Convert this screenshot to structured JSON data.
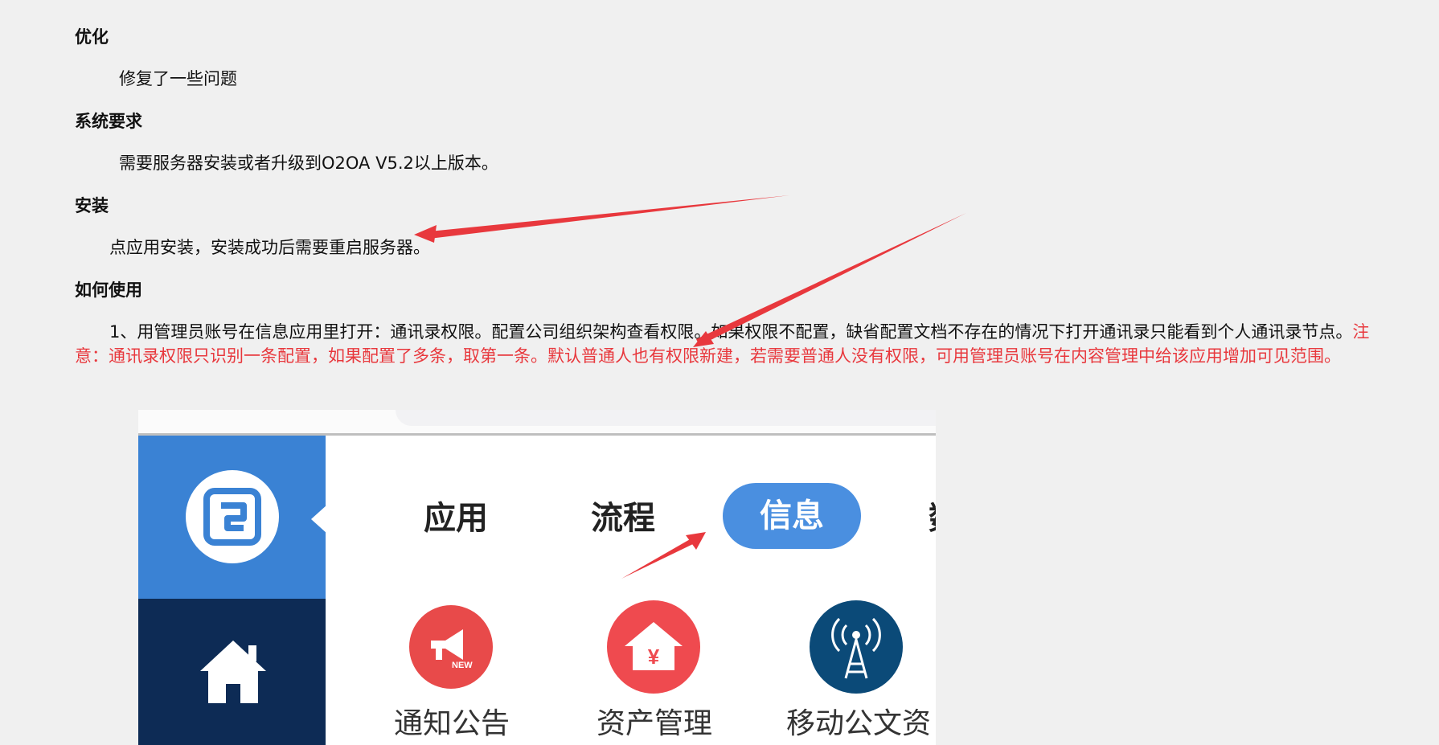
{
  "sections": {
    "optimize": {
      "heading": "优化",
      "text": "修复了一些问题"
    },
    "requirements": {
      "heading": "系统要求",
      "text": "需要服务器安装或者升级到O2OA V5.2以上版本。"
    },
    "install": {
      "heading": "安装",
      "text": "点应用安装，安装成功后需要重启服务器。"
    },
    "usage": {
      "heading": "如何使用",
      "text": "1、用管理员账号在信息应用里打开：通讯录权限。配置公司组织架构查看权限。如果权限不配置，缺省配置文档不存在的情况下打开通讯录只能看到个人通讯录节点。",
      "note": "注意：通讯录权限只识别一条配置，如果配置了多条，取第一条。默认普通人也有权限新建，若需要普通人没有权限，可用管理员账号在内容管理中给该应用增加可见范围。"
    }
  },
  "screenshot": {
    "tabs": [
      "应用",
      "流程",
      "信息"
    ],
    "active_tab": "信息",
    "cut_tab": "数",
    "apps": [
      {
        "label": "通知公告",
        "icon": "megaphone-icon",
        "color": "#e84a4a",
        "badge": "NEW"
      },
      {
        "label": "资产管理",
        "icon": "house-yen-icon",
        "color": "#ef4a4f",
        "symbol": "¥"
      },
      {
        "label": "移动公文资",
        "icon": "antenna-icon",
        "color": "#0b4a78"
      }
    ],
    "rail_icons": [
      "app-logo-icon",
      "home-icon"
    ]
  },
  "colors": {
    "accent_red": "#e8383d",
    "rail_blue": "#3a82d4",
    "rail_navy": "#0d2b55",
    "tab_blue": "#4a8fe0"
  }
}
